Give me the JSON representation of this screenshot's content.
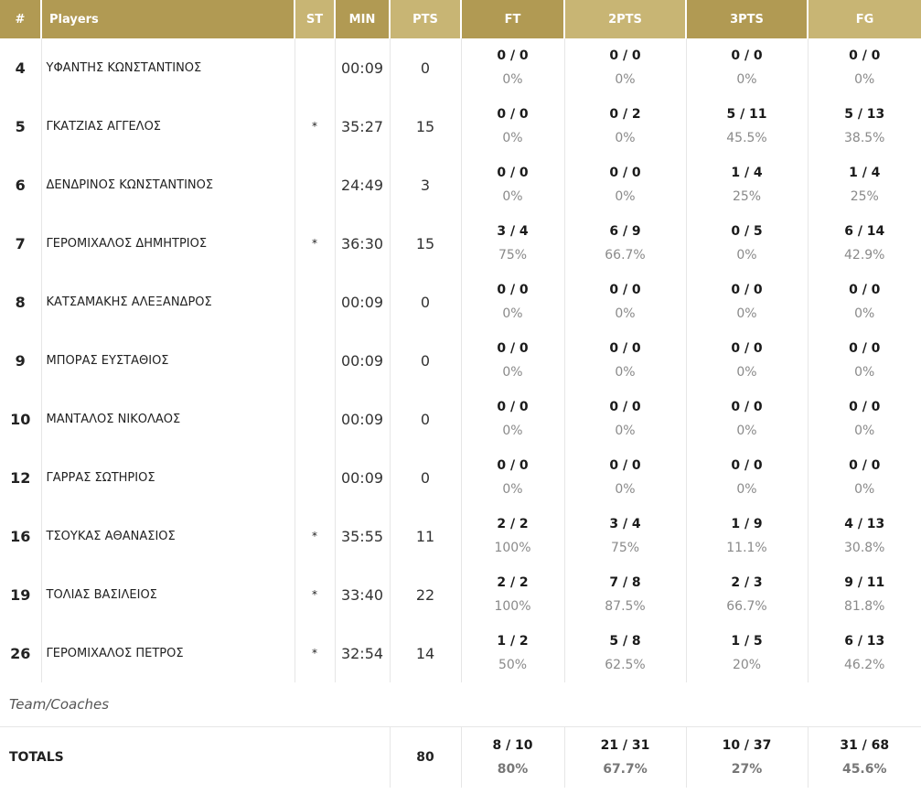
{
  "headers": {
    "num": "#",
    "players": "Players",
    "st": "ST",
    "min": "MIN",
    "pts": "PTS",
    "ft": "FT",
    "two": "2PTS",
    "three": "3PTS",
    "fg": "FG"
  },
  "colors": {
    "header_gold": "#c0ac6b",
    "header_gold_light": "#c8b574",
    "header_gold_dark": "#b19a53"
  },
  "players": [
    {
      "num": "4",
      "name": "ΥΦΑΝΤΗΣ ΚΩΝΣΤΑΝΤΙΝΟΣ",
      "st": "",
      "min": "00:09",
      "pts": "0",
      "ft": [
        "0 / 0",
        "0%"
      ],
      "two": [
        "0 / 0",
        "0%"
      ],
      "three": [
        "0 / 0",
        "0%"
      ],
      "fg": [
        "0 / 0",
        "0%"
      ]
    },
    {
      "num": "5",
      "name": "ΓΚΑΤΖΙΑΣ ΑΓΓΕΛΟΣ",
      "st": "*",
      "min": "35:27",
      "pts": "15",
      "ft": [
        "0 / 0",
        "0%"
      ],
      "two": [
        "0 / 2",
        "0%"
      ],
      "three": [
        "5 / 11",
        "45.5%"
      ],
      "fg": [
        "5 / 13",
        "38.5%"
      ]
    },
    {
      "num": "6",
      "name": "ΔΕΝΔΡΙΝΟΣ ΚΩΝΣΤΑΝΤΙΝΟΣ",
      "st": "",
      "min": "24:49",
      "pts": "3",
      "ft": [
        "0 / 0",
        "0%"
      ],
      "two": [
        "0 / 0",
        "0%"
      ],
      "three": [
        "1 / 4",
        "25%"
      ],
      "fg": [
        "1 / 4",
        "25%"
      ]
    },
    {
      "num": "7",
      "name": "ΓΕΡΟΜΙΧΑΛΟΣ ΔΗΜΗΤΡΙΟΣ",
      "st": "*",
      "min": "36:30",
      "pts": "15",
      "ft": [
        "3 / 4",
        "75%"
      ],
      "two": [
        "6 / 9",
        "66.7%"
      ],
      "three": [
        "0 / 5",
        "0%"
      ],
      "fg": [
        "6 / 14",
        "42.9%"
      ]
    },
    {
      "num": "8",
      "name": "ΚΑΤΣΑΜΑΚΗΣ ΑΛΕΞΑΝΔΡΟΣ",
      "st": "",
      "min": "00:09",
      "pts": "0",
      "ft": [
        "0 / 0",
        "0%"
      ],
      "two": [
        "0 / 0",
        "0%"
      ],
      "three": [
        "0 / 0",
        "0%"
      ],
      "fg": [
        "0 / 0",
        "0%"
      ]
    },
    {
      "num": "9",
      "name": "ΜΠΟΡΑΣ ΕΥΣΤΑΘΙΟΣ",
      "st": "",
      "min": "00:09",
      "pts": "0",
      "ft": [
        "0 / 0",
        "0%"
      ],
      "two": [
        "0 / 0",
        "0%"
      ],
      "three": [
        "0 / 0",
        "0%"
      ],
      "fg": [
        "0 / 0",
        "0%"
      ]
    },
    {
      "num": "10",
      "name": "ΜΑΝΤΑΛΟΣ ΝΙΚΟΛΑΟΣ",
      "st": "",
      "min": "00:09",
      "pts": "0",
      "ft": [
        "0 / 0",
        "0%"
      ],
      "two": [
        "0 / 0",
        "0%"
      ],
      "three": [
        "0 / 0",
        "0%"
      ],
      "fg": [
        "0 / 0",
        "0%"
      ]
    },
    {
      "num": "12",
      "name": "ΓΑΡΡΑΣ ΣΩΤΗΡΙΟΣ",
      "st": "",
      "min": "00:09",
      "pts": "0",
      "ft": [
        "0 / 0",
        "0%"
      ],
      "two": [
        "0 / 0",
        "0%"
      ],
      "three": [
        "0 / 0",
        "0%"
      ],
      "fg": [
        "0 / 0",
        "0%"
      ]
    },
    {
      "num": "16",
      "name": "ΤΣΟΥΚΑΣ ΑΘΑΝΑΣΙΟΣ",
      "st": "*",
      "min": "35:55",
      "pts": "11",
      "ft": [
        "2 / 2",
        "100%"
      ],
      "two": [
        "3 / 4",
        "75%"
      ],
      "three": [
        "1 / 9",
        "11.1%"
      ],
      "fg": [
        "4 / 13",
        "30.8%"
      ]
    },
    {
      "num": "19",
      "name": "ΤΟΛΙΑΣ ΒΑΣΙΛΕΙΟΣ",
      "st": "*",
      "min": "33:40",
      "pts": "22",
      "ft": [
        "2 / 2",
        "100%"
      ],
      "two": [
        "7 / 8",
        "87.5%"
      ],
      "three": [
        "2 / 3",
        "66.7%"
      ],
      "fg": [
        "9 / 11",
        "81.8%"
      ]
    },
    {
      "num": "26",
      "name": "ΓΕΡΟΜΙΧΑΛΟΣ ΠΕΤΡΟΣ",
      "st": "*",
      "min": "32:54",
      "pts": "14",
      "ft": [
        "1 / 2",
        "50%"
      ],
      "two": [
        "5 / 8",
        "62.5%"
      ],
      "three": [
        "1 / 5",
        "20%"
      ],
      "fg": [
        "6 / 13",
        "46.2%"
      ]
    }
  ],
  "team_label": "Team/Coaches",
  "totals": {
    "label": "TOTALS",
    "pts": "80",
    "ft": [
      "8 / 10",
      "80%"
    ],
    "two": [
      "21 / 31",
      "67.7%"
    ],
    "three": [
      "10 / 37",
      "27%"
    ],
    "fg": [
      "31 / 68",
      "45.6%"
    ]
  }
}
